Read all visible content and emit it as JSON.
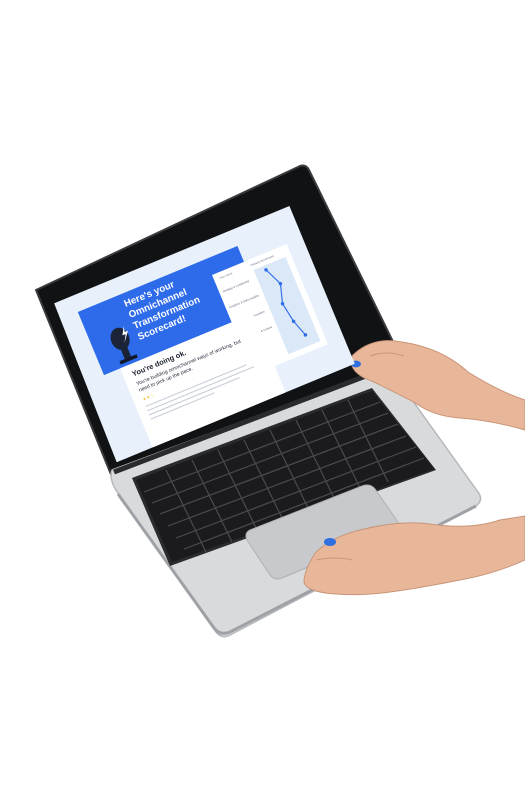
{
  "screen": {
    "title": "Here's your Omnichannel\nTransformation Scorecard!",
    "heading": "You're doing ok.",
    "subheading": "You're building omnichannel ways of working, but need to pick up the pace.",
    "legend": [
      "Your score",
      "Industry benchmark"
    ],
    "sidebar_items": [
      "Strategy & Leadership",
      "Analytics & Data Insights",
      "Omnichannel Innovation",
      "Transformation & Culture"
    ]
  },
  "colors": {
    "banner": "#2d6bea",
    "screen_bg": "#e8f1fb",
    "chart_line": "#2d6bea",
    "stars": "#f2b529",
    "nail_polish": "#2f6fe0",
    "laptop_body": "#d9dadc",
    "keys": "#1b1b1d"
  },
  "icons": [
    "microphone-icon",
    "lightning-icon"
  ]
}
